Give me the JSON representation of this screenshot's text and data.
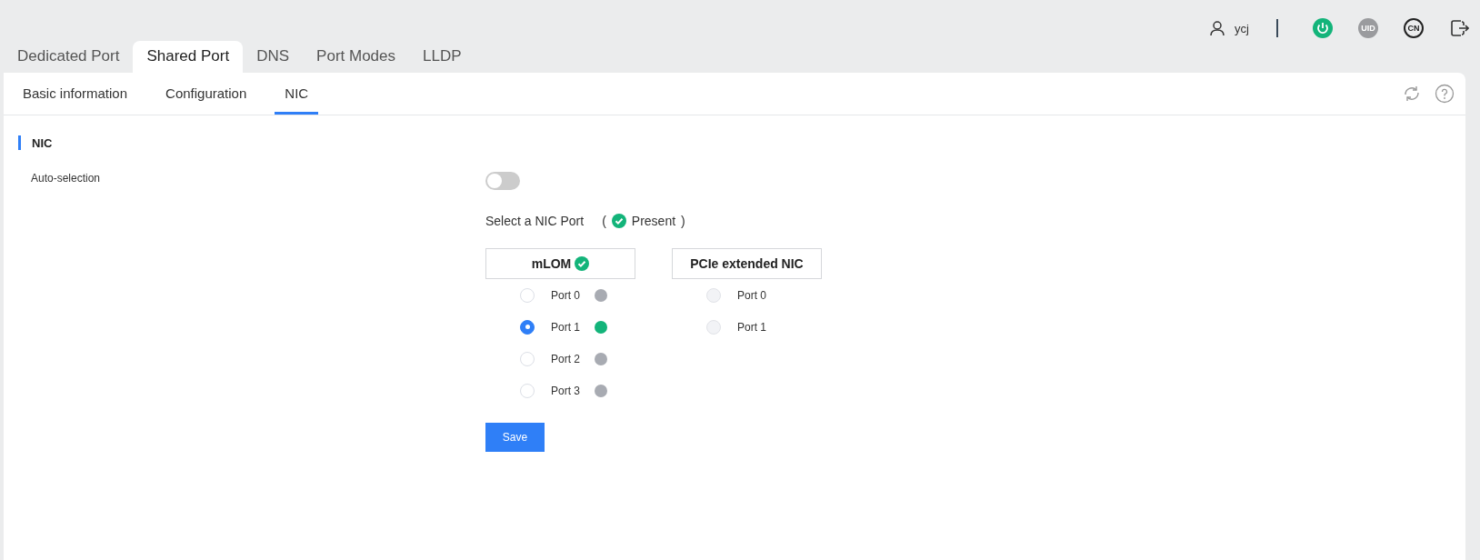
{
  "header": {
    "username": "ycj",
    "uid_badge": "UID",
    "language_badge": "CN"
  },
  "tabs": [
    {
      "label": "Dedicated Port",
      "selected": false
    },
    {
      "label": "Shared Port",
      "selected": true
    },
    {
      "label": "DNS",
      "selected": false
    },
    {
      "label": "Port Modes",
      "selected": false
    },
    {
      "label": "LLDP",
      "selected": false
    }
  ],
  "subtabs": [
    {
      "label": "Basic information",
      "selected": false
    },
    {
      "label": "Configuration",
      "selected": false
    },
    {
      "label": "NIC",
      "selected": true
    }
  ],
  "section": {
    "title": "NIC"
  },
  "auto_selection": {
    "label": "Auto-selection",
    "on": false
  },
  "nic_select": {
    "label": "Select a NIC Port",
    "legend_open": "(",
    "legend_text": "Present",
    "legend_close": ")"
  },
  "nic_groups": [
    {
      "title": "mLOM",
      "present": true,
      "ports": [
        {
          "label": "Port 0",
          "selected": false,
          "disabled": false,
          "color": "#a8abb2"
        },
        {
          "label": "Port 1",
          "selected": true,
          "disabled": false,
          "color": "#13b47a"
        },
        {
          "label": "Port 2",
          "selected": false,
          "disabled": false,
          "color": "#a8abb2"
        },
        {
          "label": "Port 3",
          "selected": false,
          "disabled": false,
          "color": "#a8abb2"
        }
      ]
    },
    {
      "title": "PCIe extended NIC",
      "present": false,
      "ports": [
        {
          "label": "Port 0",
          "selected": false,
          "disabled": true
        },
        {
          "label": "Port 1",
          "selected": false,
          "disabled": true
        }
      ]
    }
  ],
  "save_button": "Save"
}
